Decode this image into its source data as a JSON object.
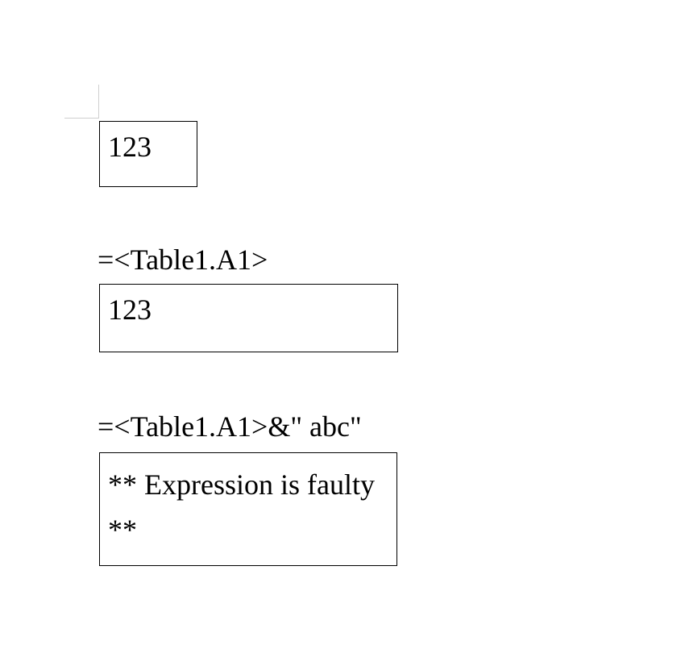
{
  "cell1": {
    "value": "123"
  },
  "group2": {
    "formula": "=<Table1.A1>",
    "value": "123"
  },
  "group3": {
    "formula": "=<Table1.A1>&\" abc\"",
    "value": "** Expression is faulty **"
  }
}
